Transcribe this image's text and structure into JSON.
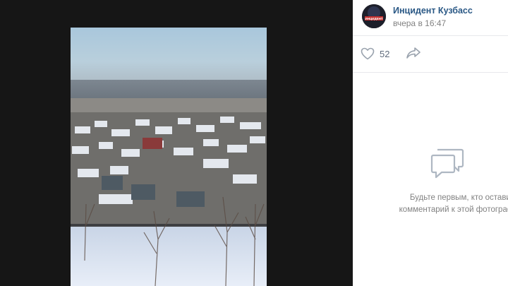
{
  "author": {
    "name": "Инцидент Кузбасс",
    "avatar_text": "ИНЦИДЕНТ",
    "time": "вчера в 16:47"
  },
  "actions": {
    "likes": "52",
    "like_icon": "heart-icon",
    "share_icon": "share-arrow-icon"
  },
  "comments": {
    "empty_icon": "comments-icon",
    "empty_line1": "Будьте первым, кто оставит",
    "empty_line2": "комментарий к этой фотографии."
  },
  "colors": {
    "link": "#2a5885",
    "muted": "#828282",
    "icon": "#99a2ad",
    "viewer_bg": "#161616"
  }
}
